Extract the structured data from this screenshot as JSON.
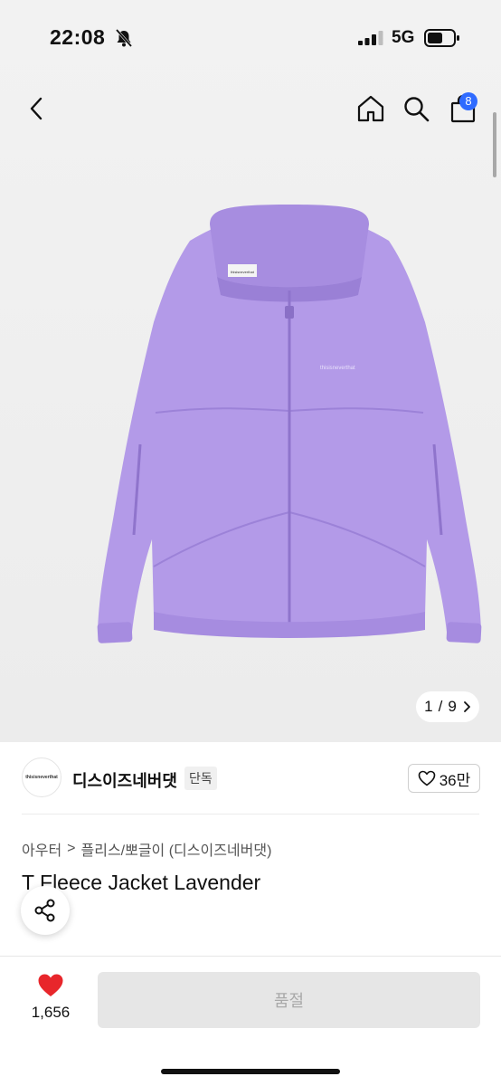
{
  "status_bar": {
    "time": "22:08",
    "network": "5G",
    "bell_icon": "bell-slash-icon",
    "signal_icon": "cellular-signal-icon",
    "battery_icon": "battery-icon"
  },
  "nav": {
    "back_icon": "chevron-left-icon",
    "home_icon": "home-icon",
    "search_icon": "search-icon",
    "cart_icon": "shopping-bag-icon",
    "cart_count": "8"
  },
  "gallery": {
    "image_alt": "lavender fleece zip jacket",
    "current_page": "1",
    "separator": "/",
    "total_pages": "9",
    "jacket_color": "#b39ae8",
    "logo_text": "thisisneverthat"
  },
  "brand": {
    "name": "디스이즈네버댓",
    "badge": "단독",
    "likes": "36만",
    "logo_text": "thisisneverthat"
  },
  "product": {
    "breadcrumb": [
      "아우터",
      "플리스/뽀글이 (디스이즈네버댓)"
    ],
    "breadcrumb_separator": ">",
    "title": "T Fleece Jacket Lavender"
  },
  "bottom_bar": {
    "wish_count": "1,656",
    "soldout_label": "품절"
  },
  "colors": {
    "accent": "#2f6bff",
    "heart": "#e8262b",
    "jacket": "#b39ae8"
  }
}
